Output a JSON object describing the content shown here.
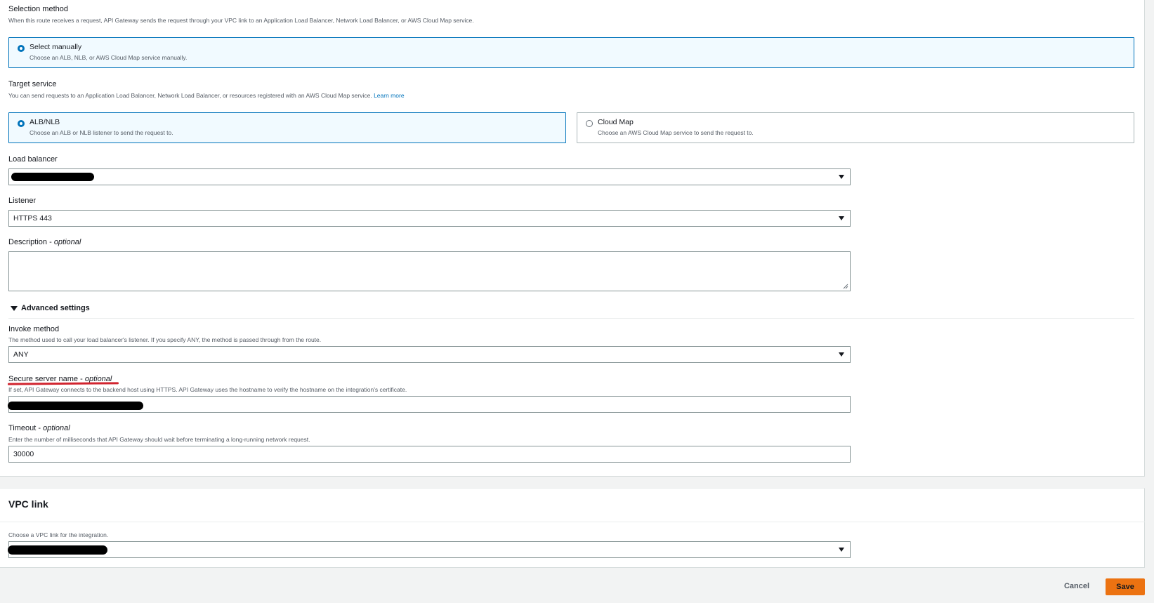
{
  "selection_method": {
    "label": "Selection method",
    "description": "When this route receives a request, API Gateway sends the request through your VPC link to an Application Load Balancer, Network Load Balancer, or AWS Cloud Map service.",
    "option": {
      "title": "Select manually",
      "description": "Choose an ALB, NLB, or AWS Cloud Map service manually."
    }
  },
  "target_service": {
    "label": "Target service",
    "description": "You can send requests to an Application Load Balancer, Network Load Balancer, or resources registered with an AWS Cloud Map service.",
    "learn_more": "Learn more",
    "options": [
      {
        "title": "ALB/NLB",
        "description": "Choose an ALB or NLB listener to send the request to.",
        "selected": true
      },
      {
        "title": "Cloud Map",
        "description": "Choose an AWS Cloud Map service to send the request to.",
        "selected": false
      }
    ]
  },
  "load_balancer": {
    "label": "Load balancer"
  },
  "listener": {
    "label": "Listener",
    "value": "HTTPS 443"
  },
  "description_field": {
    "label": "Description",
    "optional": "optional"
  },
  "advanced_settings": {
    "label": "Advanced settings"
  },
  "invoke_method": {
    "label": "Invoke method",
    "description": "The method used to call your load balancer's listener. If you specify ANY, the method is passed through from the route.",
    "value": "ANY"
  },
  "secure_server_name": {
    "label": "Secure server name",
    "optional": "optional",
    "description": "If set, API Gateway connects to the backend host using HTTPS. API Gateway uses the hostname to verify the hostname on the integration's certificate."
  },
  "timeout": {
    "label": "Timeout",
    "optional": "optional",
    "description": "Enter the number of milliseconds that API Gateway should wait before terminating a long-running network request.",
    "value": "30000"
  },
  "vpc_link": {
    "title": "VPC link",
    "description": "Choose a VPC link for the integration."
  },
  "actions": {
    "cancel": "Cancel",
    "save": "Save"
  },
  "colors": {
    "accent": "#0073bb",
    "save_button": "#ec7211",
    "annotation_underline": "#d1242f"
  }
}
